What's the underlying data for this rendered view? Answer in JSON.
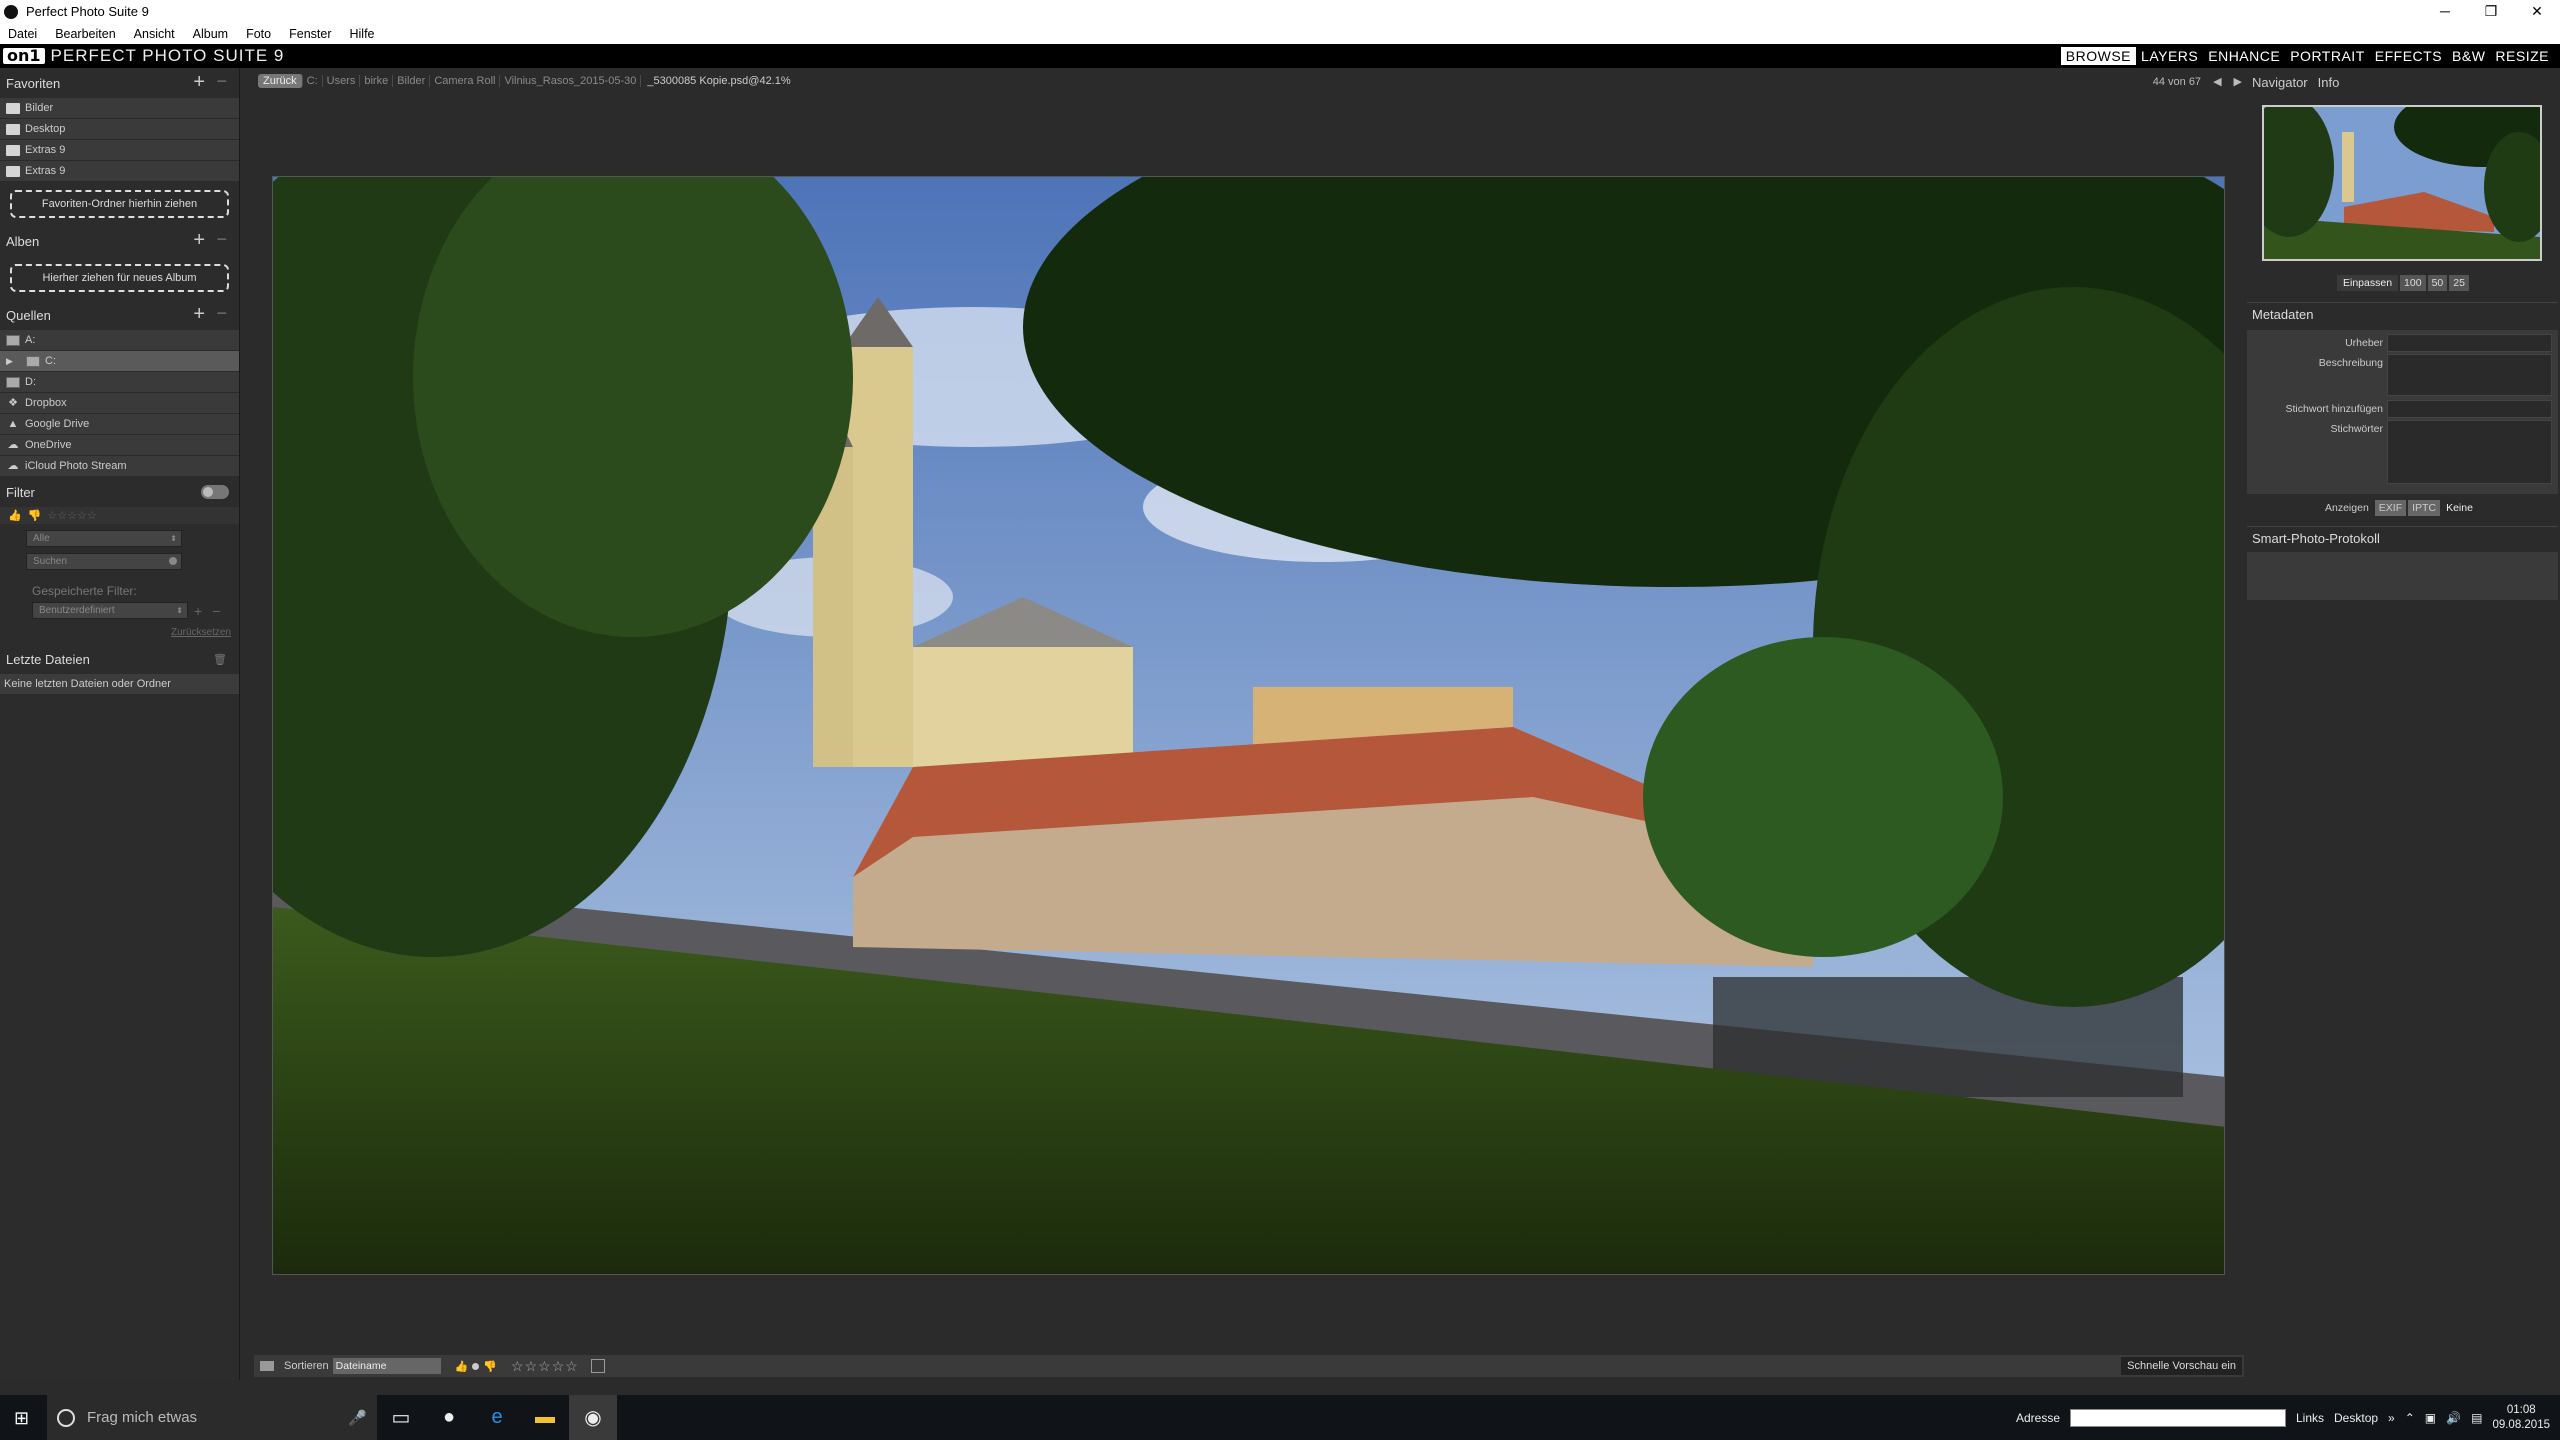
{
  "window": {
    "title": "Perfect Photo Suite 9",
    "minimize": "─",
    "maximize": "❐",
    "close": "✕"
  },
  "menu": [
    "Datei",
    "Bearbeiten",
    "Ansicht",
    "Album",
    "Foto",
    "Fenster",
    "Hilfe"
  ],
  "brand": {
    "logo": "on1",
    "name": "PERFECT PHOTO SUITE 9"
  },
  "modules": [
    "BROWSE",
    "LAYERS",
    "ENHANCE",
    "PORTRAIT",
    "EFFECTS",
    "B&W",
    "RESIZE"
  ],
  "active_module": "BROWSE",
  "left": {
    "favorites": {
      "title": "Favoriten",
      "items": [
        "Bilder",
        "Desktop",
        "Extras 9",
        "Extras 9"
      ],
      "drop": "Favoriten-Ordner hierhin ziehen"
    },
    "albums": {
      "title": "Alben",
      "drop": "Hierher ziehen für neues Album"
    },
    "sources": {
      "title": "Quellen",
      "items": [
        "A:",
        "C:",
        "D:",
        "Dropbox",
        "Google Drive",
        "OneDrive",
        "iCloud Photo Stream"
      ]
    },
    "filter": {
      "title": "Filter",
      "select_all": "Alle",
      "search_placeholder": "Suchen",
      "saved_label": "Gespeicherte Filter:",
      "saved_value": "Benutzerdefiniert",
      "reset": "Zurücksetzen"
    },
    "recent": {
      "title": "Letzte Dateien",
      "empty": "Keine letzten Dateien oder Ordner"
    }
  },
  "path": {
    "back": "Zurück",
    "crumbs": [
      "C:",
      "Users",
      "birke",
      "Bilder",
      "Camera Roll",
      "Vilnius_Rasos_2015-05-30"
    ],
    "file": "_5300085 Kopie.psd@42.1%"
  },
  "pager": {
    "text": "44 von 67",
    "prev": "◀",
    "next": "▶"
  },
  "bottom": {
    "sort_label": "Sortieren",
    "sort_value": "Dateiname",
    "quick_preview": "Schnelle Vorschau ein"
  },
  "right": {
    "tabs": [
      "Navigator",
      "Info"
    ],
    "zoom": [
      "Einpassen",
      "100",
      "50",
      "25"
    ],
    "metadata": {
      "title": "Metadaten",
      "fields": [
        "Urheber",
        "Beschreibung",
        "Stichwort hinzufügen",
        "Stichwörter"
      ],
      "show_label": "Anzeigen",
      "show_opts": [
        "EXIF",
        "IPTC",
        "Keine"
      ]
    },
    "protocol": "Smart-Photo-Protokoll"
  },
  "taskbar": {
    "search_placeholder": "Frag mich etwas",
    "address_label": "Adresse",
    "links": "Links",
    "desktop": "Desktop",
    "time": "01:08",
    "date": "09.08.2015"
  }
}
